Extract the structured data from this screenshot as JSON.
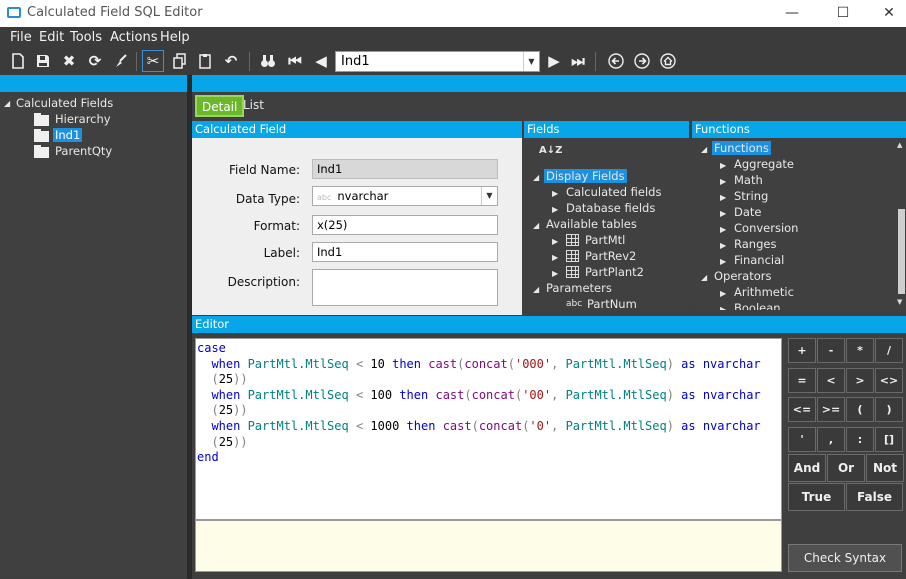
{
  "window": {
    "title": "Calculated Field SQL Editor"
  },
  "menu": [
    "File",
    "Edit",
    "Tools",
    "Actions",
    "Help"
  ],
  "toolbar": {
    "record_value": "Ind1"
  },
  "tree": {
    "root": "Calculated Fields",
    "items": [
      "Hierarchy",
      "Ind1",
      "ParentQty"
    ],
    "selected": "Ind1"
  },
  "tabs": [
    "Detail",
    "List"
  ],
  "panels": {
    "calculated_field": "Calculated Field",
    "fields": "Fields",
    "functions": "Functions",
    "editor": "Editor"
  },
  "form": {
    "field_name_label": "Field Name:",
    "field_name": "Ind1",
    "data_type_label": "Data Type:",
    "data_type": "nvarchar",
    "data_type_prefix": "abc",
    "format_label": "Format:",
    "format": "x(25)",
    "label_label": "Label:",
    "label": "Ind1",
    "description_label": "Description:",
    "description": ""
  },
  "fields_tree": {
    "sort_glyph": "A↓Z",
    "display_fields": "Display Fields",
    "calculated_fields": "Calculated fields",
    "database_fields": "Database fields",
    "available_tables": "Available tables",
    "tables": [
      "PartMtl",
      "PartRev2",
      "PartPlant2"
    ],
    "parameters": "Parameters",
    "param_type": "abc",
    "param_name": "PartNum"
  },
  "functions_tree": {
    "functions": "Functions",
    "items": [
      "Aggregate",
      "Math",
      "String",
      "Date",
      "Conversion",
      "Ranges",
      "Financial"
    ],
    "operators": "Operators",
    "operator_items": [
      "Arithmetic",
      "Boolean"
    ]
  },
  "editor": {
    "lines": [
      [
        {
          "t": "case",
          "c": "kw"
        }
      ],
      [
        {
          "t": "  when ",
          "c": "kw"
        },
        {
          "t": "PartMtl.MtlSeq",
          "c": "col"
        },
        {
          "t": " < ",
          "c": "op"
        },
        {
          "t": "10",
          "c": "num"
        },
        {
          "t": " then ",
          "c": "kw"
        },
        {
          "t": "cast",
          "c": "fn"
        },
        {
          "t": "(",
          "c": "op"
        },
        {
          "t": "concat",
          "c": "fn"
        },
        {
          "t": "(",
          "c": "op"
        },
        {
          "t": "'000'",
          "c": "str"
        },
        {
          "t": ", ",
          "c": "op"
        },
        {
          "t": "PartMtl.MtlSeq",
          "c": "col"
        },
        {
          "t": ") ",
          "c": "op"
        },
        {
          "t": "as",
          "c": "kw"
        },
        {
          "t": " nvarchar",
          "c": "kw"
        }
      ],
      [
        {
          "t": "  (",
          "c": "op"
        },
        {
          "t": "25",
          "c": "num"
        },
        {
          "t": "))",
          "c": "op"
        }
      ],
      [
        {
          "t": "  when ",
          "c": "kw"
        },
        {
          "t": "PartMtl.MtlSeq",
          "c": "col"
        },
        {
          "t": " < ",
          "c": "op"
        },
        {
          "t": "100",
          "c": "num"
        },
        {
          "t": " then ",
          "c": "kw"
        },
        {
          "t": "cast",
          "c": "fn"
        },
        {
          "t": "(",
          "c": "op"
        },
        {
          "t": "concat",
          "c": "fn"
        },
        {
          "t": "(",
          "c": "op"
        },
        {
          "t": "'00'",
          "c": "str"
        },
        {
          "t": ", ",
          "c": "op"
        },
        {
          "t": "PartMtl.MtlSeq",
          "c": "col"
        },
        {
          "t": ") ",
          "c": "op"
        },
        {
          "t": "as",
          "c": "kw"
        },
        {
          "t": " nvarchar",
          "c": "kw"
        }
      ],
      [
        {
          "t": "  (",
          "c": "op"
        },
        {
          "t": "25",
          "c": "num"
        },
        {
          "t": "))",
          "c": "op"
        }
      ],
      [
        {
          "t": "  when ",
          "c": "kw"
        },
        {
          "t": "PartMtl.MtlSeq",
          "c": "col"
        },
        {
          "t": " < ",
          "c": "op"
        },
        {
          "t": "1000",
          "c": "num"
        },
        {
          "t": " then ",
          "c": "kw"
        },
        {
          "t": "cast",
          "c": "fn"
        },
        {
          "t": "(",
          "c": "op"
        },
        {
          "t": "concat",
          "c": "fn"
        },
        {
          "t": "(",
          "c": "op"
        },
        {
          "t": "'0'",
          "c": "str"
        },
        {
          "t": ", ",
          "c": "op"
        },
        {
          "t": "PartMtl.MtlSeq",
          "c": "col"
        },
        {
          "t": ") ",
          "c": "op"
        },
        {
          "t": "as",
          "c": "kw"
        },
        {
          "t": " nvarchar",
          "c": "kw"
        }
      ],
      [
        {
          "t": "  (",
          "c": "op"
        },
        {
          "t": "25",
          "c": "num"
        },
        {
          "t": "))",
          "c": "op"
        }
      ],
      [
        {
          "t": "end",
          "c": "kw"
        }
      ]
    ]
  },
  "keypad": {
    "rows": [
      [
        "+",
        "-",
        "*",
        "/"
      ],
      [
        "=",
        "<",
        ">",
        "<>"
      ],
      [
        "<=",
        ">=",
        "(",
        ")"
      ],
      [
        "'",
        ",",
        ":",
        "[]"
      ]
    ],
    "bool": [
      "And",
      "Or",
      "Not"
    ],
    "tf": [
      "True",
      "False"
    ],
    "check_syntax": "Check Syntax"
  },
  "colors": {
    "accent": "#07a6e8",
    "tab_active": "#6bb82b",
    "selection": "#1e90e0",
    "background": "#3f3f3f"
  }
}
